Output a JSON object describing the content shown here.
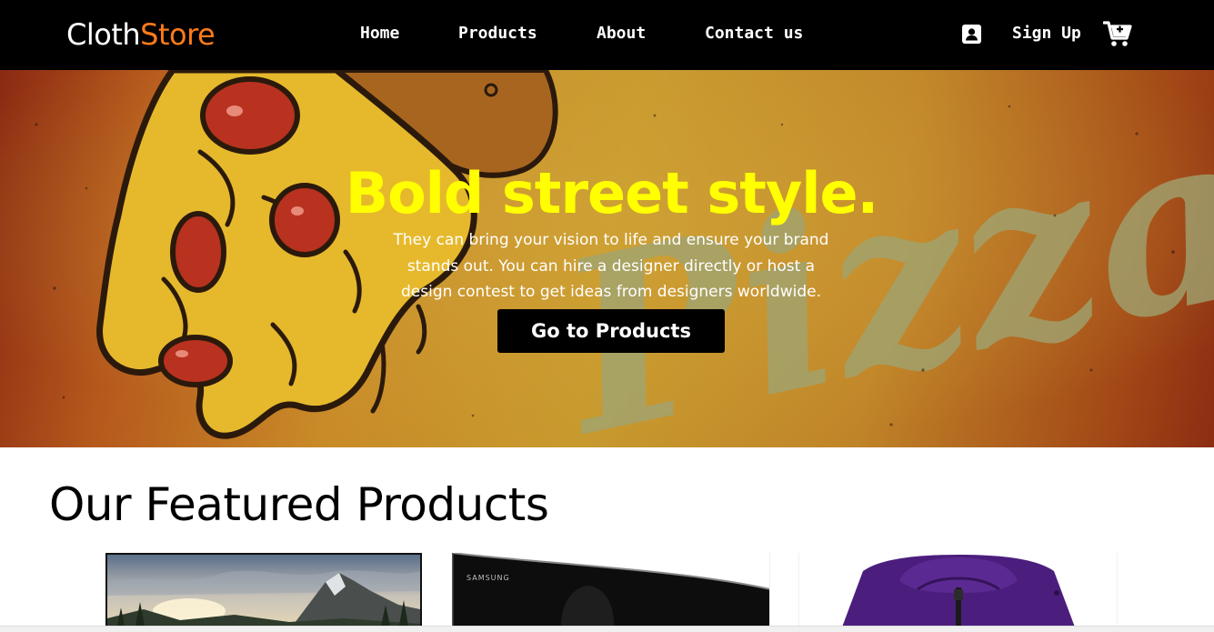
{
  "brand": {
    "part1": "Cloth",
    "part2": "Store"
  },
  "nav": {
    "home": "Home",
    "products": "Products",
    "about": "About",
    "contact": "Contact us",
    "signup": "Sign Up"
  },
  "hero": {
    "title": "Bold street style.",
    "text": "They can bring your vision to life and ensure your brand stands out. You can hire a designer directly or host a design contest to get ideas from designers worldwide.",
    "button": "Go to Products",
    "background_word": "Pizza"
  },
  "featured": {
    "title": "Our Featured Products",
    "products": [
      {
        "image": "mountain-landscape-monitor"
      },
      {
        "image": "samsung-curved-monitor",
        "brand_text": "SAMSUNG"
      },
      {
        "image": "purple-jacket"
      }
    ]
  },
  "colors": {
    "navbar": "#000000",
    "brand_accent": "#ff7a1a",
    "hero_title": "#ffff00",
    "button": "#000000"
  },
  "icons": [
    "user-icon",
    "cart-icon"
  ]
}
